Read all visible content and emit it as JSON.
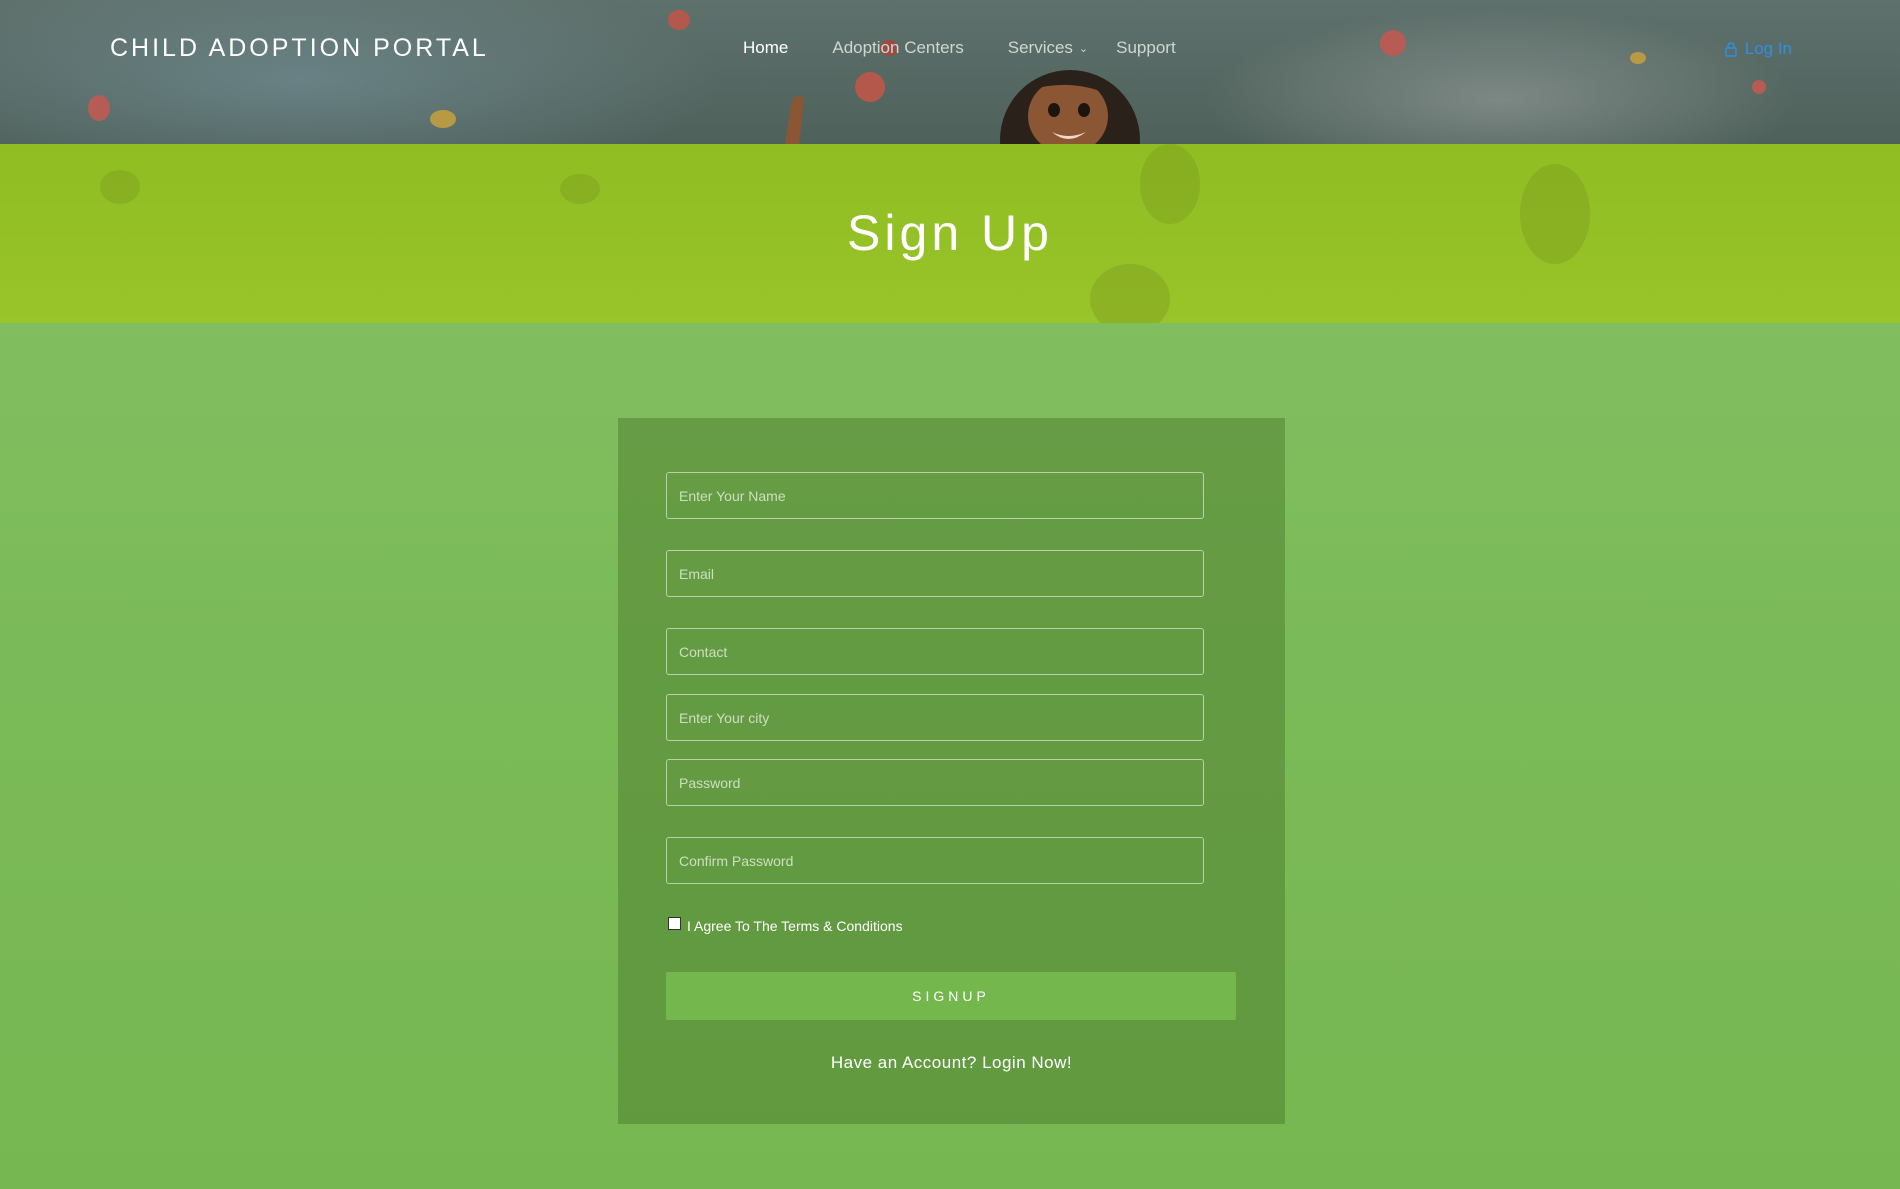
{
  "header": {
    "brand": "CHILD ADOPTION PORTAL",
    "nav": [
      {
        "label": "Home",
        "active": true
      },
      {
        "label": "Adoption Centers",
        "active": false
      },
      {
        "label": "Services",
        "active": false,
        "has_dropdown": true
      },
      {
        "label": "Support",
        "active": false
      }
    ],
    "login_label": "Log In",
    "login_icon": "lock-icon",
    "dropdown_icon": "chevron-down-icon"
  },
  "banner": {
    "title": "Sign Up"
  },
  "form": {
    "fields": [
      {
        "name": "name",
        "placeholder": "Enter Your Name",
        "value": ""
      },
      {
        "name": "email",
        "placeholder": "Email",
        "value": ""
      },
      {
        "name": "contact",
        "placeholder": "Contact",
        "value": ""
      },
      {
        "name": "city",
        "placeholder": "Enter Your city",
        "value": ""
      },
      {
        "name": "password",
        "placeholder": "Password",
        "value": ""
      },
      {
        "name": "confirm_password",
        "placeholder": "Confirm Password",
        "value": ""
      }
    ],
    "terms_label": "I Agree To The Terms & Conditions",
    "terms_checked": false,
    "signup_label": "SIGNUP",
    "login_link": "Have an Account? Login Now!"
  },
  "colors": {
    "login_link": "#2f8fe0",
    "banner": "#94c126",
    "page_bg": "#7bba58",
    "button": "#74b74c"
  }
}
